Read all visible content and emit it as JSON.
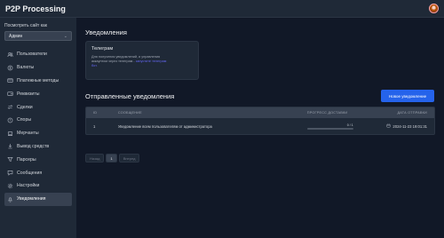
{
  "app": {
    "title": "P2P Processing"
  },
  "sidebar": {
    "view_as_label": "Посмотреть сайт как",
    "view_as_value": "Админ",
    "items": [
      {
        "label": "Пользователи",
        "icon": "users-icon"
      },
      {
        "label": "Валюты",
        "icon": "currency-icon"
      },
      {
        "label": "Платежные методы",
        "icon": "credit-card-icon"
      },
      {
        "label": "Реквизиты",
        "icon": "wallet-icon"
      },
      {
        "label": "Сделки",
        "icon": "exchange-icon"
      },
      {
        "label": "Споры",
        "icon": "dispute-icon"
      },
      {
        "label": "Мерчанты",
        "icon": "store-icon"
      },
      {
        "label": "Вывод средств",
        "icon": "withdraw-icon"
      },
      {
        "label": "Парсеры",
        "icon": "filter-icon"
      },
      {
        "label": "Сообщения",
        "icon": "message-icon"
      },
      {
        "label": "Настройки",
        "icon": "gear-icon"
      },
      {
        "label": "Уведомления",
        "icon": "bell-icon",
        "active": true
      }
    ]
  },
  "main": {
    "notifications_title": "Уведомления",
    "telegram": {
      "title": "Телеграм",
      "desc_lines": [
        "Для получения уведомлений, и управления",
        "аккаунтом через телеграм -"
      ],
      "link": "запустите телеграм",
      "link_tail": "бот."
    },
    "sent_title": "Отправленные уведомления",
    "new_button": "Новое уведомление",
    "table": {
      "headers": {
        "id": "ID",
        "message": "СООБЩЕНИЕ",
        "progress": "ПРОГРЕСС ДОСТАВКИ",
        "date": "ДАТА ОТПРАВКИ"
      },
      "rows": [
        {
          "id": "1",
          "message": "Уведомление всем пользователям от администратора",
          "progress_text": "0 / 1",
          "progress_fraction": 0,
          "date": "2024-11-23 19:01:31"
        }
      ]
    },
    "pagination": {
      "prev": "Назад",
      "page": "1",
      "next": "Вперед"
    }
  },
  "colors": {
    "accent": "#2563eb",
    "link": "#6366f1",
    "background": "#111827",
    "panel": "#1f2937"
  }
}
